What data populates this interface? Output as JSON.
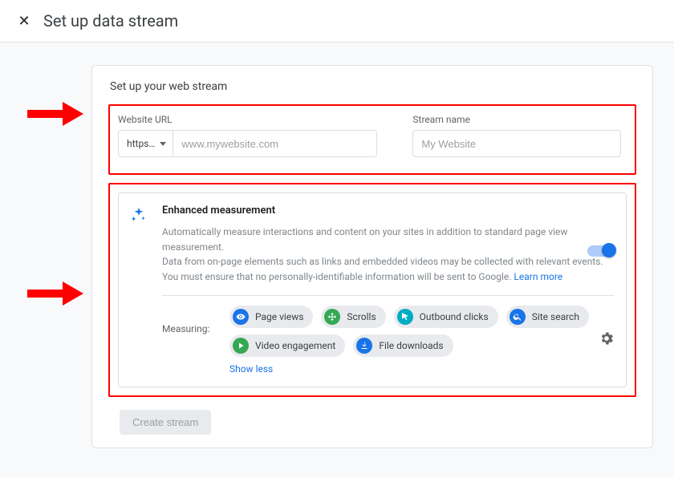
{
  "header": {
    "title": "Set up data stream"
  },
  "card": {
    "heading": "Set up your web stream",
    "website_url_label": "Website URL",
    "stream_name_label": "Stream name",
    "protocol_selected": "https…",
    "url_placeholder": "www.mywebsite.com",
    "name_placeholder": "My Website"
  },
  "enhanced": {
    "title": "Enhanced measurement",
    "desc1": "Automatically measure interactions and content on your sites in addition to standard page view measurement.",
    "desc2": "Data from on-page elements such as links and embedded videos may be collected with relevant events. You must ensure that no personally-identifiable information will be sent to Google. ",
    "learn_more": "Learn more",
    "measuring_label": "Measuring:",
    "chips": [
      {
        "label": "Page views",
        "color": "#1a73e8",
        "icon": "eye"
      },
      {
        "label": "Scrolls",
        "color": "#34a853",
        "icon": "scroll"
      },
      {
        "label": "Outbound clicks",
        "color": "#00acc1",
        "icon": "cursor"
      },
      {
        "label": "Site search",
        "color": "#1a73e8",
        "icon": "search"
      },
      {
        "label": "Video engagement",
        "color": "#34a853",
        "icon": "play"
      },
      {
        "label": "File downloads",
        "color": "#1a73e8",
        "icon": "download"
      }
    ],
    "show_less": "Show less",
    "toggle_on": true
  },
  "footer": {
    "create_label": "Create stream"
  }
}
